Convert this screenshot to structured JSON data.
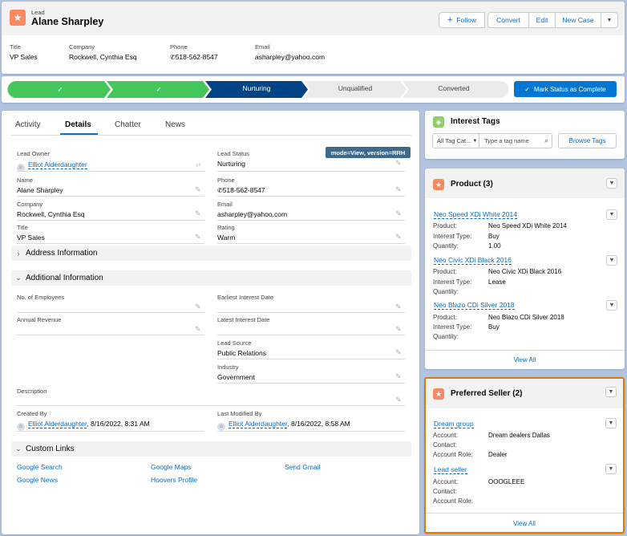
{
  "header": {
    "object_label": "Lead",
    "record_name": "Alane Sharpley",
    "follow_label": "Follow",
    "actions": [
      "Convert",
      "Edit",
      "New Case"
    ],
    "highlights": [
      {
        "label": "Title",
        "value": "VP Sales"
      },
      {
        "label": "Company",
        "value": "Rockwell, Cynthia Esq"
      },
      {
        "label": "Phone",
        "value": "518-562-8547"
      },
      {
        "label": "Email",
        "value": "asharpley@yahoo.com"
      }
    ]
  },
  "path": {
    "steps": [
      "",
      "",
      "Nurturing",
      "Unqualified",
      "Converted"
    ],
    "current": "Nurturing",
    "mark_button": "Mark Status as Complete"
  },
  "tabs": [
    "Activity",
    "Details",
    "Chatter",
    "News"
  ],
  "active_tab": "Details",
  "mode_badge": "mode=View, version=RRH",
  "details": {
    "lead_owner_label": "Lead Owner",
    "lead_owner": "Elliot Alderdaughter",
    "lead_status_label": "Lead Status",
    "lead_status": "Nurturing",
    "name_label": "Name",
    "name": "Alane Sharpley",
    "phone_label": "Phone",
    "phone": "518-562-8547",
    "company_label": "Company",
    "company": "Rockwell, Cynthia Esq",
    "email_label": "Email",
    "email": "asharpley@yahoo.com",
    "title_label": "Title",
    "title": "VP Sales",
    "rating_label": "Rating",
    "rating": "Warm"
  },
  "sections": {
    "address": "Address Information",
    "additional": "Additional Information",
    "custom_links": "Custom Links"
  },
  "additional": {
    "employees_label": "No. of Employees",
    "earliest_label": "Earliest Interest Date",
    "revenue_label": "Annual Revenue",
    "latest_label": "Latest Interest Date",
    "source_label": "Lead Source",
    "source": "Public Relations",
    "industry_label": "Industry",
    "industry": "Government",
    "description_label": "Description",
    "created_label": "Created By",
    "created_by": "Elliot Alderdaughter",
    "created_date": ", 8/16/2022, 8:31 AM",
    "modified_label": "Last Modified By",
    "modified_by": "Elliot Alderdaughter",
    "modified_date": ", 8/16/2022, 8:58 AM"
  },
  "custom_links": [
    "Google Search",
    "Google Maps",
    "Send Gmail",
    "Google News",
    "Hoovers Profile"
  ],
  "interest_tags": {
    "title": "Interest Tags",
    "category": "All Tag Cat...",
    "placeholder": "Type a tag name",
    "browse": "Browse Tags"
  },
  "product": {
    "title": "Product (3)",
    "labels": {
      "product": "Product:",
      "interest_type": "Interest Type:",
      "quantity": "Quantity:"
    },
    "items": [
      {
        "name": "Neo Speed XDi White 2014",
        "product": "Neo Speed XDi White 2014",
        "interest_type": "Buy",
        "quantity": "1.00"
      },
      {
        "name": "Neo Civic XDi Black 2016",
        "product": "Neo Civic XDi Black 2016",
        "interest_type": "Lease",
        "quantity": ""
      },
      {
        "name": "Neo Blazo CDi Silver 2018",
        "product": "Neo Blazo CDi Silver 2018",
        "interest_type": "Buy",
        "quantity": ""
      }
    ],
    "view_all": "View All"
  },
  "preferred_seller": {
    "title": "Preferred Seller (2)",
    "labels": {
      "account": "Account:",
      "contact": "Contact:",
      "role": "Account Role:"
    },
    "items": [
      {
        "name": "Dream group",
        "account": "Dream dealers Dallas",
        "contact": "",
        "role": "Dealer"
      },
      {
        "name": "Lead seller",
        "account": "OOOGLEEE",
        "contact": "",
        "role": ""
      }
    ],
    "view_all": "View All"
  },
  "colors": {
    "brand": "#0176d3",
    "path_complete": "#45c65a",
    "path_current": "#014486",
    "lead_icon": "#f88962",
    "tag_icon": "#8fcf6a",
    "highlight_border": "#e07b00"
  }
}
